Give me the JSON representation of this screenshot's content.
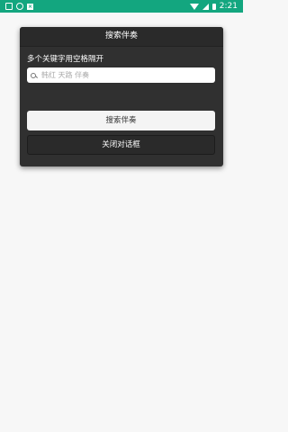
{
  "status_bar": {
    "time": "2:21",
    "color": "#13a67f",
    "left_icons": [
      "app-square-icon",
      "circle-icon",
      "x-app-icon"
    ],
    "right_icons": [
      "wifi-icon",
      "signal-icon",
      "battery-icon"
    ]
  },
  "dialog": {
    "title": "搜索伴奏",
    "hint": "多个关键字用空格隔开",
    "search": {
      "value": "",
      "placeholder": "韩红 天路 伴奏"
    },
    "search_button": "搜索伴奏",
    "close_button": "关闭对话框"
  }
}
